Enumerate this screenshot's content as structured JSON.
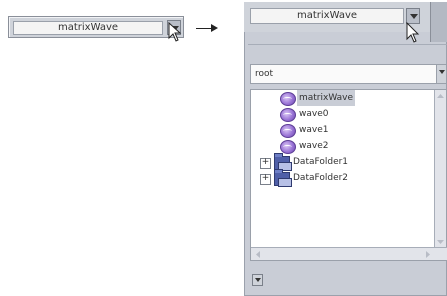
{
  "collapsed": {
    "selected_value": "matrixWave",
    "cursor_icon": "arrow-cursor"
  },
  "arrow_icon": "right-arrow-icon",
  "expanded": {
    "selected_value": "matrixWave",
    "cursor_icon": "arrow-cursor",
    "folder_select": {
      "value": "root"
    },
    "tree": {
      "items": [
        {
          "label": "matrixWave",
          "type": "wave",
          "selected": true
        },
        {
          "label": "wave0",
          "type": "wave",
          "selected": false
        },
        {
          "label": "wave1",
          "type": "wave",
          "selected": false
        },
        {
          "label": "wave2",
          "type": "wave",
          "selected": false
        },
        {
          "label": "DataFolder1",
          "type": "folder",
          "expander": "+"
        },
        {
          "label": "DataFolder2",
          "type": "folder",
          "expander": "+"
        }
      ]
    }
  }
}
